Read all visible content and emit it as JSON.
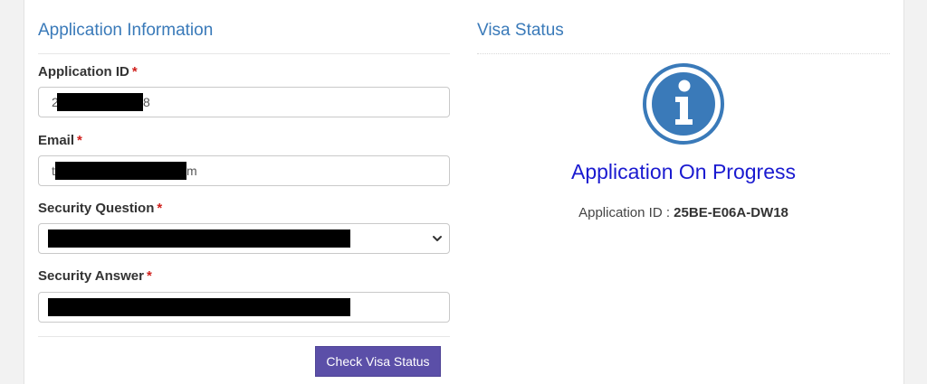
{
  "application_info": {
    "heading": "Application Information",
    "fields": {
      "application_id": {
        "label": "Application ID",
        "required_mark": "*",
        "value_start": "2",
        "value_end": "8"
      },
      "email": {
        "label": "Email",
        "required_mark": "*",
        "value_start": "t",
        "value_end": "m"
      },
      "security_question": {
        "label": "Security Question",
        "required_mark": "*"
      },
      "security_answer": {
        "label": "Security Answer",
        "required_mark": "*"
      }
    },
    "submit_label": "Check Visa Status"
  },
  "visa_status": {
    "heading": "Visa Status",
    "icon": "info-circle-icon",
    "status_text": "Application On Progress",
    "app_id_label": "Application ID :",
    "app_id_value": "25BE-E06A-DW18"
  },
  "colors": {
    "heading": "#3a7ab9",
    "status": "#1a1ad0",
    "icon": "#3a7ab9",
    "button": "#5b4fa8",
    "required": "#d0201c"
  }
}
